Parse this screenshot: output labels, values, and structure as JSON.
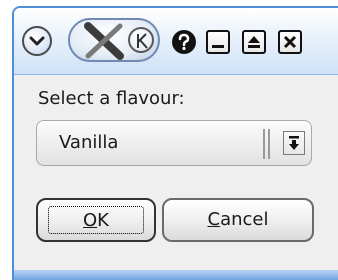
{
  "titlebar": {
    "menu_icon": "chevron-down-icon",
    "pin_icons": [
      "x-logo-icon",
      "k-logo-icon"
    ],
    "help_icon": "help-icon",
    "minimize_icon": "minimize-icon",
    "maximize_icon": "maximize-icon",
    "close_icon": "close-icon"
  },
  "dialog": {
    "prompt": "Select a flavour:",
    "combo": {
      "selected": "Vanilla"
    },
    "ok": {
      "mnemonic": "O",
      "rest": "K"
    },
    "cancel": {
      "mnemonic": "C",
      "rest": "ancel"
    }
  },
  "colors": {
    "frame": "#4f8fd9",
    "background": "#efefef"
  }
}
